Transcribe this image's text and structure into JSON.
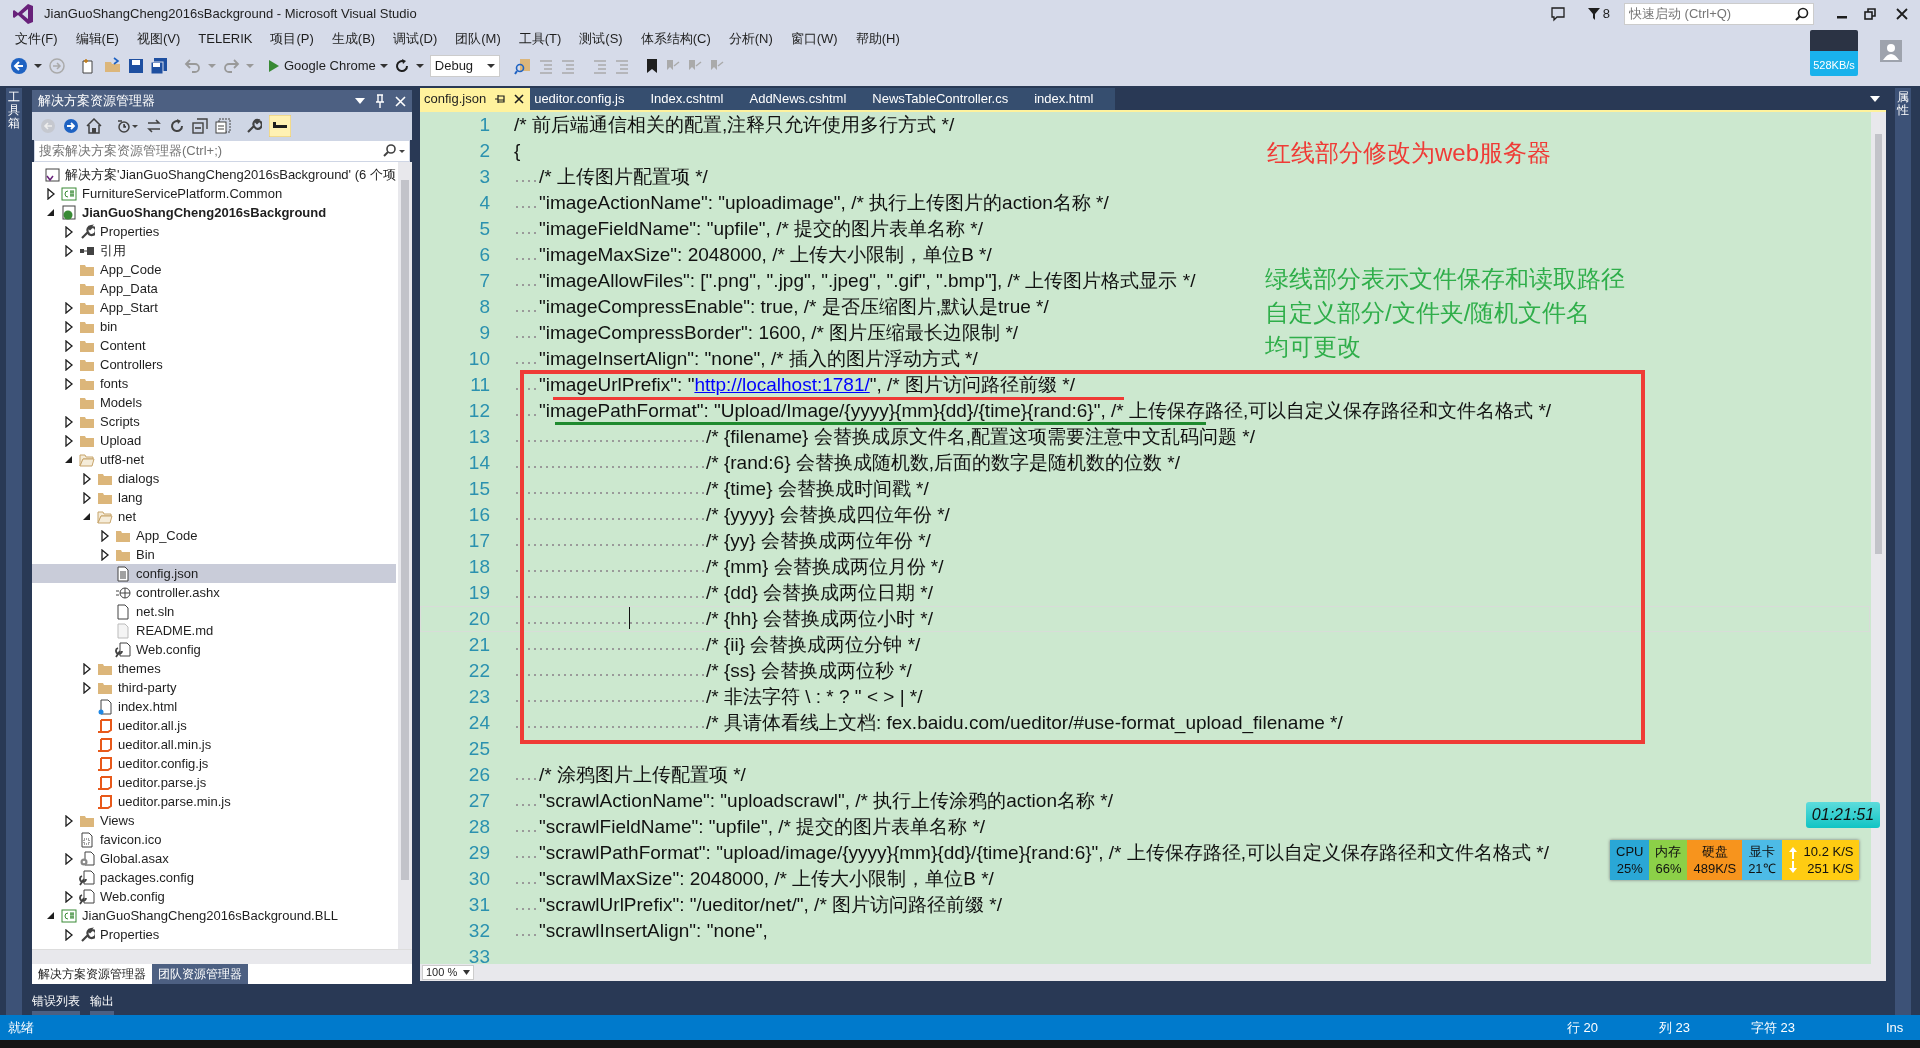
{
  "window": {
    "title": "JianGuoShangCheng2016sBackground - Microsoft Visual Studio",
    "notifications": "8",
    "quick_launch": {
      "placeholder": "快速启动 (Ctrl+Q)"
    },
    "net_speed": "528KB/s"
  },
  "menu": [
    "文件(F)",
    "编辑(E)",
    "视图(V)",
    "TELERIK",
    "项目(P)",
    "生成(B)",
    "调试(D)",
    "团队(M)",
    "工具(T)",
    "测试(S)",
    "体系结构(C)",
    "分析(N)",
    "窗口(W)",
    "帮助(H)"
  ],
  "toolbar": {
    "target": "Google Chrome",
    "configuration": "Debug"
  },
  "left_strip": "工具箱",
  "right_strip": "属性",
  "solution_explorer": {
    "title": "解决方案资源管理器",
    "preview_on": true,
    "search": {
      "placeholder": "搜索解决方案资源管理器(Ctrl+;)"
    },
    "root": "解决方案'JianGuoShangCheng2016sBackground' (6 个项",
    "tree": [
      {
        "label": "FurnitureServicePlatform.Common",
        "kind": "cs-project",
        "expanded": false,
        "selected": false,
        "startup": false
      },
      {
        "label": "JianGuoShangCheng2016sBackground",
        "kind": "web-project",
        "expanded": true,
        "selected": false,
        "startup": true,
        "children": [
          {
            "label": "Properties",
            "kind": "wrench",
            "expanded": false,
            "selected": false
          },
          {
            "label": "引用",
            "kind": "reference",
            "expanded": false,
            "selected": false
          },
          {
            "label": "App_Code",
            "kind": "folder",
            "selected": false
          },
          {
            "label": "App_Data",
            "kind": "folder",
            "selected": false
          },
          {
            "label": "App_Start",
            "kind": "folder",
            "expanded": false,
            "selected": false
          },
          {
            "label": "bin",
            "kind": "folder",
            "expanded": false,
            "selected": false
          },
          {
            "label": "Content",
            "kind": "folder",
            "expanded": false,
            "selected": false
          },
          {
            "label": "Controllers",
            "kind": "folder",
            "expanded": false,
            "selected": false
          },
          {
            "label": "fonts",
            "kind": "folder",
            "expanded": false,
            "selected": false
          },
          {
            "label": "Models",
            "kind": "folder",
            "selected": false
          },
          {
            "label": "Scripts",
            "kind": "folder",
            "expanded": false,
            "selected": false
          },
          {
            "label": "Upload",
            "kind": "folder",
            "expanded": false,
            "selected": false
          },
          {
            "label": "utf8-net",
            "kind": "open-folder",
            "expanded": true,
            "selected": false,
            "children": [
              {
                "label": "dialogs",
                "kind": "folder",
                "expanded": false,
                "selected": false
              },
              {
                "label": "lang",
                "kind": "folder",
                "expanded": false,
                "selected": false
              },
              {
                "label": "net",
                "kind": "open-folder",
                "expanded": true,
                "selected": false,
                "children": [
                  {
                    "label": "App_Code",
                    "kind": "folder",
                    "expanded": false,
                    "selected": false
                  },
                  {
                    "label": "Bin",
                    "kind": "folder",
                    "expanded": false,
                    "selected": false
                  },
                  {
                    "label": "config.json",
                    "kind": "document",
                    "selected": true
                  },
                  {
                    "label": "controller.ashx",
                    "kind": "web-handler",
                    "selected": false
                  },
                  {
                    "label": "net.sln",
                    "kind": "blank-file",
                    "selected": false
                  },
                  {
                    "label": "README.md",
                    "kind": "markdown",
                    "selected": false
                  },
                  {
                    "label": "Web.config",
                    "kind": "config",
                    "selected": false
                  }
                ]
              },
              {
                "label": "themes",
                "kind": "folder",
                "expanded": false,
                "selected": false
              },
              {
                "label": "third-party",
                "kind": "folder",
                "expanded": false,
                "selected": false
              },
              {
                "label": "index.html",
                "kind": "html",
                "selected": false
              },
              {
                "label": "ueditor.all.js",
                "kind": "script",
                "selected": false
              },
              {
                "label": "ueditor.all.min.js",
                "kind": "script",
                "selected": false
              },
              {
                "label": "ueditor.config.js",
                "kind": "script",
                "selected": false
              },
              {
                "label": "ueditor.parse.js",
                "kind": "script",
                "selected": false
              },
              {
                "label": "ueditor.parse.min.js",
                "kind": "script",
                "selected": false
              }
            ]
          },
          {
            "label": "Views",
            "kind": "folder",
            "expanded": false,
            "selected": false
          },
          {
            "label": "favicon.ico",
            "kind": "image-file",
            "selected": false
          },
          {
            "label": "Global.asax",
            "kind": "asax",
            "expanded": false,
            "selected": false
          },
          {
            "label": "packages.config",
            "kind": "config",
            "selected": false
          },
          {
            "label": "Web.config",
            "kind": "config",
            "expanded": false,
            "selected": false
          }
        ]
      },
      {
        "label": "JianGuoShangCheng2016sBackground.BLL",
        "kind": "cs-project",
        "expanded": true,
        "selected": false,
        "startup": false,
        "children": [
          {
            "label": "Properties",
            "kind": "wrench",
            "expanded": false,
            "selected": false
          }
        ]
      }
    ],
    "tabs": [
      {
        "label": "解决方案资源管理器",
        "selected": true
      },
      {
        "label": "团队资源管理器",
        "selected": false
      }
    ]
  },
  "output_tabs": [
    "错误列表",
    "输出"
  ],
  "editor": {
    "tabs": [
      {
        "label": "config.json",
        "selected": true
      },
      {
        "label": "ueditor.config.js",
        "selected": false
      },
      {
        "label": "Index.cshtml",
        "selected": false
      },
      {
        "label": "AddNews.cshtml",
        "selected": false
      },
      {
        "label": "NewsTableController.cs",
        "selected": false
      },
      {
        "label": "index.html",
        "selected": false
      }
    ],
    "lines": [
      {
        "number": "1",
        "kind": "top",
        "text": "/* 前后端通信相关的配置,注释只允许使用多行方式 */",
        "current": false
      },
      {
        "number": "2",
        "kind": "top",
        "text": "{",
        "current": false
      },
      {
        "number": "3",
        "kind": "member",
        "text": "/* 上传图片配置项 */",
        "current": false
      },
      {
        "number": "4",
        "kind": "member",
        "text": "\"imageActionName\": \"uploadimage\", /* 执行上传图片的action名称 */",
        "current": false
      },
      {
        "number": "5",
        "kind": "member",
        "text": "\"imageFieldName\": \"upfile\", /* 提交的图片表单名称 */",
        "current": false
      },
      {
        "number": "6",
        "kind": "member",
        "text": "\"imageMaxSize\": 2048000, /* 上传大小限制，单位B */",
        "current": false
      },
      {
        "number": "7",
        "kind": "member",
        "text": "\"imageAllowFiles\": [\".png\", \".jpg\", \".jpeg\", \".gif\", \".bmp\"], /* 上传图片格式显示 */",
        "current": false
      },
      {
        "number": "8",
        "kind": "member",
        "text": "\"imageCompressEnable\": true, /* 是否压缩图片,默认是true */",
        "current": false
      },
      {
        "number": "9",
        "kind": "member",
        "text": "\"imageCompressBorder\": 1600, /* 图片压缩最长边限制 */",
        "current": false
      },
      {
        "number": "10",
        "kind": "member",
        "text": "\"imageInsertAlign\": \"none\", /* 插入的图片浮动方式 */",
        "current": false
      },
      {
        "number": "11",
        "kind": "member",
        "text": "\"imageUrlPrefix\": \"",
        "link": "http://localhost:1781/",
        "text_after": "\", /* 图片访问路径前缀 */",
        "current": false
      },
      {
        "number": "12",
        "kind": "member",
        "text": "\"imagePathFormat\": \"Upload/Image/{yyyy}{mm}{dd}/{time}{rand:6}\", /* 上传保存路径,可以自定义保存路径和文件名格式 */",
        "current": false
      },
      {
        "number": "13",
        "kind": "continuation",
        "text": "/* {filename} 会替换成原文件名,配置这项需要注意中文乱码问题 */",
        "current": false
      },
      {
        "number": "14",
        "kind": "continuation",
        "text": "/* {rand:6} 会替换成随机数,后面的数字是随机数的位数 */",
        "current": false
      },
      {
        "number": "15",
        "kind": "continuation",
        "text": "/* {time} 会替换成时间戳 */",
        "current": false
      },
      {
        "number": "16",
        "kind": "continuation",
        "text": "/* {yyyy} 会替换成四位年份 */",
        "current": false
      },
      {
        "number": "17",
        "kind": "continuation",
        "text": "/* {yy} 会替换成两位年份 */",
        "current": false
      },
      {
        "number": "18",
        "kind": "continuation",
        "text": "/* {mm} 会替换成两位月份 */",
        "current": false
      },
      {
        "number": "19",
        "kind": "continuation",
        "text": "/* {dd} 会替换成两位日期 */",
        "current": false
      },
      {
        "number": "20",
        "kind": "continuation",
        "text": "/* {hh} 会替换成两位小时 */",
        "current": true
      },
      {
        "number": "21",
        "kind": "continuation",
        "text": "/* {ii} 会替换成两位分钟 */",
        "current": false
      },
      {
        "number": "22",
        "kind": "continuation",
        "text": "/* {ss} 会替换成两位秒 */",
        "current": false
      },
      {
        "number": "23",
        "kind": "continuation",
        "text": "/* 非法字符 \\ : * ? \" < > | */",
        "current": false
      },
      {
        "number": "24",
        "kind": "continuation",
        "text": "/* 具请体看线上文档: fex.baidu.com/ueditor/#use-format_upload_filename */",
        "current": false
      },
      {
        "number": "25",
        "kind": "blank",
        "current": false
      },
      {
        "number": "26",
        "kind": "member",
        "text": "/* 涂鸦图片上传配置项 */",
        "current": false
      },
      {
        "number": "27",
        "kind": "member",
        "text": "\"scrawlActionName\": \"uploadscrawl\", /* 执行上传涂鸦的action名称 */",
        "current": false
      },
      {
        "number": "28",
        "kind": "member",
        "text": "\"scrawlFieldName\": \"upfile\", /* 提交的图片表单名称 */",
        "current": false
      },
      {
        "number": "29",
        "kind": "member",
        "text": "\"scrawlPathFormat\": \"upload/image/{yyyy}{mm}{dd}/{time}{rand:6}\", /* 上传保存路径,可以自定义保存路径和文件名格式 */",
        "current": false
      },
      {
        "number": "30",
        "kind": "member",
        "text": "\"scrawlMaxSize\": 2048000, /* 上传大小限制，单位B */",
        "current": false
      },
      {
        "number": "31",
        "kind": "member",
        "text": "\"scrawlUrlPrefix\": \"/ueditor/net/\", /* 图片访问路径前缀 */",
        "current": false
      },
      {
        "number": "32",
        "kind": "member",
        "text": "\"scrawlInsertAlign\": \"none\",",
        "current": false
      },
      {
        "number": "33",
        "kind": "blank",
        "current": false
      }
    ],
    "zoom": "100 %"
  },
  "annotations": {
    "red_note": "红线部分修改为web服务器",
    "green_note": [
      "绿线部分表示文件保存和读取路径",
      "自定义部分/文件夹/随机文件名",
      "均可更改"
    ]
  },
  "desktop_widgets": {
    "clock": "01:21:51",
    "monitor": [
      {
        "label": "CPU",
        "value": "25%",
        "color": "#2aa7d6"
      },
      {
        "label": "内存",
        "value": "66%",
        "color": "#8cd048"
      },
      {
        "label": "硬盘",
        "value": "489K/S",
        "color": "#f7941d"
      },
      {
        "label": "显卡",
        "value": "21℃",
        "color": "#4dbbe6"
      }
    ],
    "upload": "10.2 K/S",
    "download": "251 K/S"
  },
  "status_bar": {
    "message": "就绪",
    "line": "行 20",
    "column": "列 23",
    "char": "字符 23",
    "mode": "Ins"
  }
}
